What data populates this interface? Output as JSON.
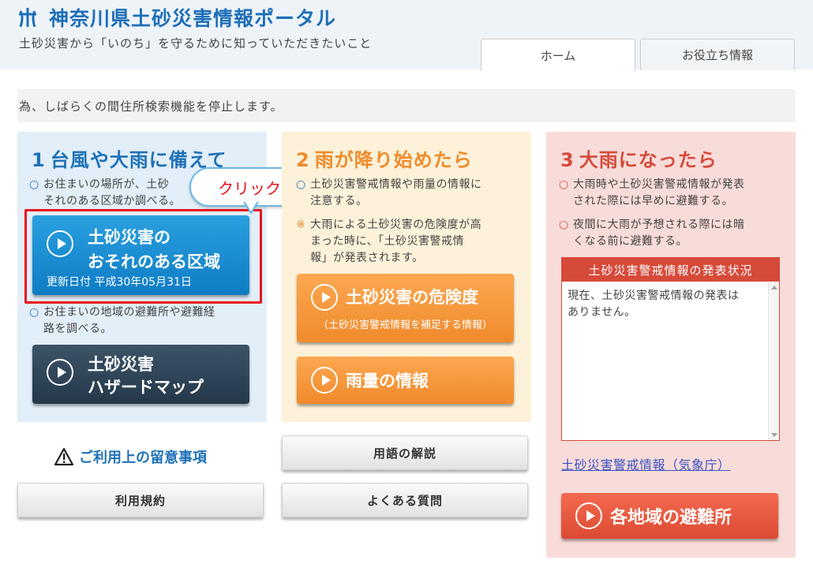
{
  "header": {
    "title": "神奈川県土砂災害情報ポータル",
    "subtitle": "土砂災害から「いのち」を守るために知っていただきたいこと",
    "tabs": [
      {
        "label": "ホーム",
        "active": true
      },
      {
        "label": "お役立ち情報",
        "active": false
      }
    ]
  },
  "notice": "為、しばらくの間住所検索機能を停止します。",
  "col1": {
    "num": "1",
    "title": "台風や大雨に備えて",
    "bullet1": "お住まいの場所が、土砂災害のおそれのある区域か調べる。",
    "bullet1_l1": "お住まいの場所が、土砂",
    "bullet1_l2": "それのある区域か調べる。",
    "btn_area": {
      "line1": "土砂災害の",
      "line2": "おそれのある区域",
      "updated": "更新日付 平成30年05月31日"
    },
    "bullet2_l1": "お住まいの地域の避難所や避難経",
    "bullet2_l2": "路を調べる。",
    "btn_hazard": {
      "line1": "土砂災害",
      "line2": "ハザードマップ"
    }
  },
  "callout": "クリック",
  "col2": {
    "num": "2",
    "title": "雨が降り始めたら",
    "bullet1_l1": "土砂災害警戒情報や雨量の情報に",
    "bullet1_l2": "注意する。",
    "note_l1": "大雨による土砂災害の危険度が高",
    "note_l2": "まった時に、「土砂災害警戒情",
    "note_l3": "報」が発表されます。",
    "btn_danger": {
      "line1": "土砂災害の危険度",
      "line2": "（土砂災害警戒情報を補足する情報）"
    },
    "btn_rain": {
      "line1": "雨量の情報"
    }
  },
  "col3": {
    "num": "3",
    "title": "大雨になったら",
    "bullet1_l1": "大雨時や土砂災害警戒情報が発表",
    "bullet1_l2": "された際には早めに避難する。",
    "bullet2_l1": "夜間に大雨が予想される際には暗",
    "bullet2_l2": "くなる前に避難する。",
    "status_title": "土砂災害警戒情報の発表状況",
    "status_l1": "現在、土砂災害警戒情報の発表は",
    "status_l2": "ありません。",
    "jma_link": "土砂災害警戒情報（気象庁）",
    "btn_shelter": "各地域の避難所"
  },
  "footer": {
    "notes": "ご利用上の留意事項",
    "terms": "利用規約",
    "glossary": "用語の解説",
    "faq": "よくある質問"
  },
  "colors": {
    "blue": "#1f72b6",
    "orange": "#ef8b2a",
    "red": "#d64a3a",
    "highlight": "#e8141e"
  }
}
